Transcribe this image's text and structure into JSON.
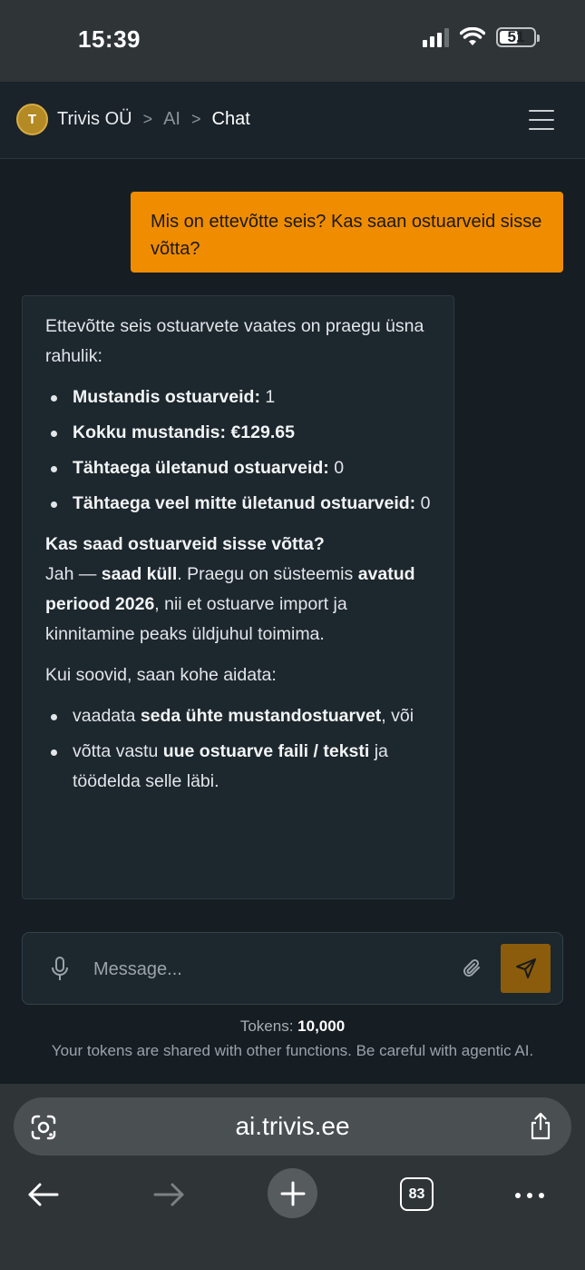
{
  "status_bar": {
    "time": "15:39",
    "battery": "51"
  },
  "header": {
    "avatar_initial": "T",
    "breadcrumb": {
      "company": "Trivis OÜ",
      "section": "AI",
      "page": "Chat"
    },
    "separator": ">"
  },
  "chat": {
    "user_message": "Mis on ettevõtte seis? Kas saan ostuarveid sisse võtta?",
    "assistant": {
      "intro": "Ettevõtte seis ostuarvete vaates on praegu üsna rahulik:",
      "stats": [
        {
          "label": "Mustandis ostuarveid:",
          "value": "1"
        },
        {
          "label": "Kokku mustandis: €129.65",
          "value": ""
        },
        {
          "label": "Tähtaega ületanud ostuarveid:",
          "value": "0"
        },
        {
          "label": "Tähtaega veel mitte ületanud ostuarveid:",
          "value": "0"
        }
      ],
      "question": "Kas saad ostuarveid sisse võtta?",
      "answer": {
        "yes_prefix": "Jah — ",
        "yes_bold": "saad küll",
        "mid": ". Praegu on süsteemis ",
        "period_bold": "avatud periood 2026",
        "tail": ", nii et ostuarve import ja kinnitamine peaks üldjuhul toimima."
      },
      "offer": "Kui soovid, saan kohe aidata:",
      "options": [
        {
          "pre": "vaadata ",
          "bold": "seda ühte mustandostuarvet",
          "post": ", või"
        },
        {
          "pre": "võtta vastu ",
          "bold": "uue ostuarve faili / teksti",
          "post": " ja töödelda selle läbi."
        }
      ]
    }
  },
  "composer": {
    "placeholder": "Message...",
    "tokens_label": "Tokens: ",
    "tokens_value": "10,000",
    "note": "Your tokens are shared with other functions. Be careful with agentic AI."
  },
  "browser": {
    "url": "ai.trivis.ee",
    "tab_count": "83"
  },
  "colors": {
    "accent": "#f08c00",
    "send_button": "#8a5c0c",
    "background": "#161e24"
  }
}
